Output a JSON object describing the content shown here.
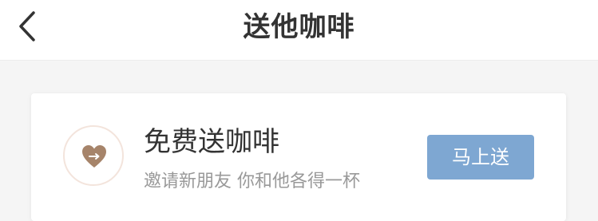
{
  "nav": {
    "title": "送他咖啡",
    "back_icon": "chevron-left-icon"
  },
  "card": {
    "icon": "heart-arrow-icon",
    "title": "免费送咖啡",
    "subtitle": "邀请新朋友 你和他各得一杯",
    "button_label": "马上送"
  },
  "colors": {
    "background": "#f5f5f5",
    "heart": "#a6846a",
    "avatar_border": "#f3e4dc",
    "button": "#7ea7d2",
    "title_text": "#333333",
    "subtitle_text": "#999999"
  }
}
